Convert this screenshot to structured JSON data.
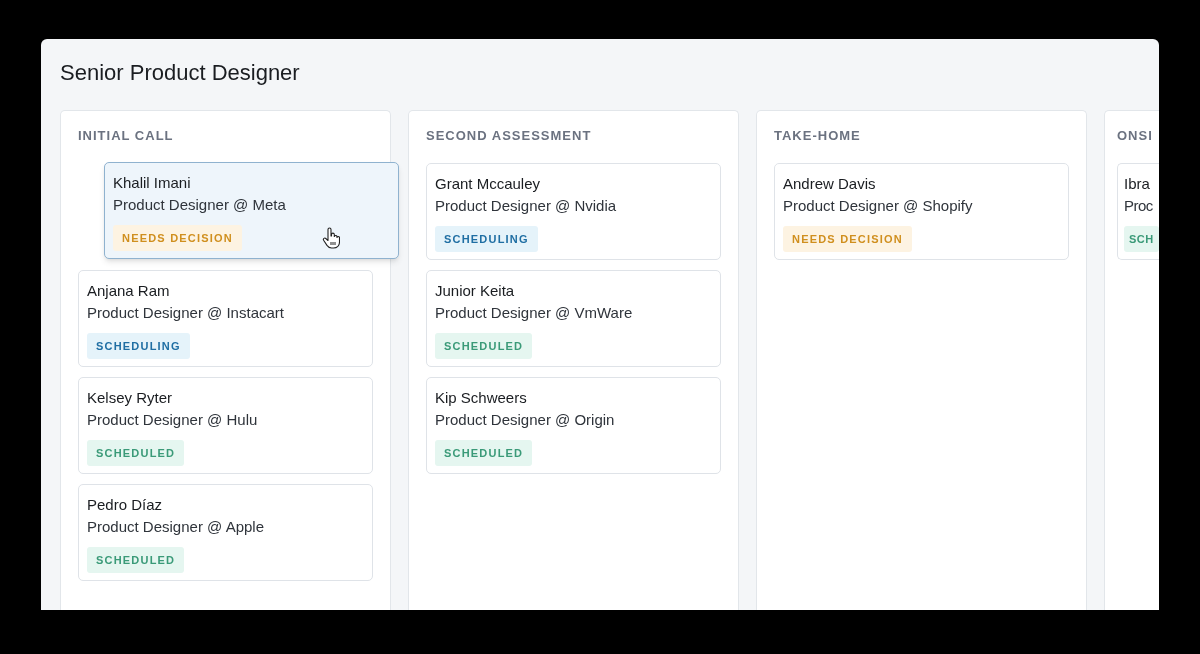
{
  "title": "Senior Product Designer",
  "columns": [
    {
      "title": "INITIAL CALL",
      "cards": [
        {
          "name": "Khalil Imani",
          "role": "Product Designer @ Meta",
          "status": {
            "label": "NEEDS DECISION",
            "kind": "needs_decision"
          },
          "dragging": true
        },
        {
          "name": "Anjana Ram",
          "role": "Product Designer @ Instacart",
          "status": {
            "label": "SCHEDULING",
            "kind": "scheduling"
          },
          "dragging": false
        },
        {
          "name": "Kelsey Ryter",
          "role": "Product Designer @ Hulu",
          "status": {
            "label": "SCHEDULED",
            "kind": "scheduled"
          },
          "dragging": false
        },
        {
          "name": "Pedro Díaz",
          "role": "Product Designer @ Apple",
          "status": {
            "label": "SCHEDULED",
            "kind": "scheduled"
          },
          "dragging": false
        }
      ]
    },
    {
      "title": "SECOND ASSESSMENT",
      "cards": [
        {
          "name": "Grant Mccauley",
          "role": "Product Designer @ Nvidia",
          "status": {
            "label": "SCHEDULING",
            "kind": "scheduling"
          },
          "dragging": false
        },
        {
          "name": "Junior Keita",
          "role": "Product Designer @ VmWare",
          "status": {
            "label": "SCHEDULED",
            "kind": "scheduled"
          },
          "dragging": false
        },
        {
          "name": "Kip Schweers",
          "role": "Product Designer @ Origin",
          "status": {
            "label": "SCHEDULED",
            "kind": "scheduled"
          },
          "dragging": false
        }
      ]
    },
    {
      "title": "TAKE-HOME",
      "cards": [
        {
          "name": "Andrew Davis",
          "role": "Product Designer @ Shopify",
          "status": {
            "label": "NEEDS DECISION",
            "kind": "needs_decision"
          },
          "dragging": false
        }
      ]
    },
    {
      "title": "ONSI",
      "cards": [
        {
          "name": "Ibra",
          "role": "Proc",
          "status": {
            "label": "SCH",
            "kind": "scheduled"
          },
          "dragging": false
        }
      ]
    }
  ]
}
